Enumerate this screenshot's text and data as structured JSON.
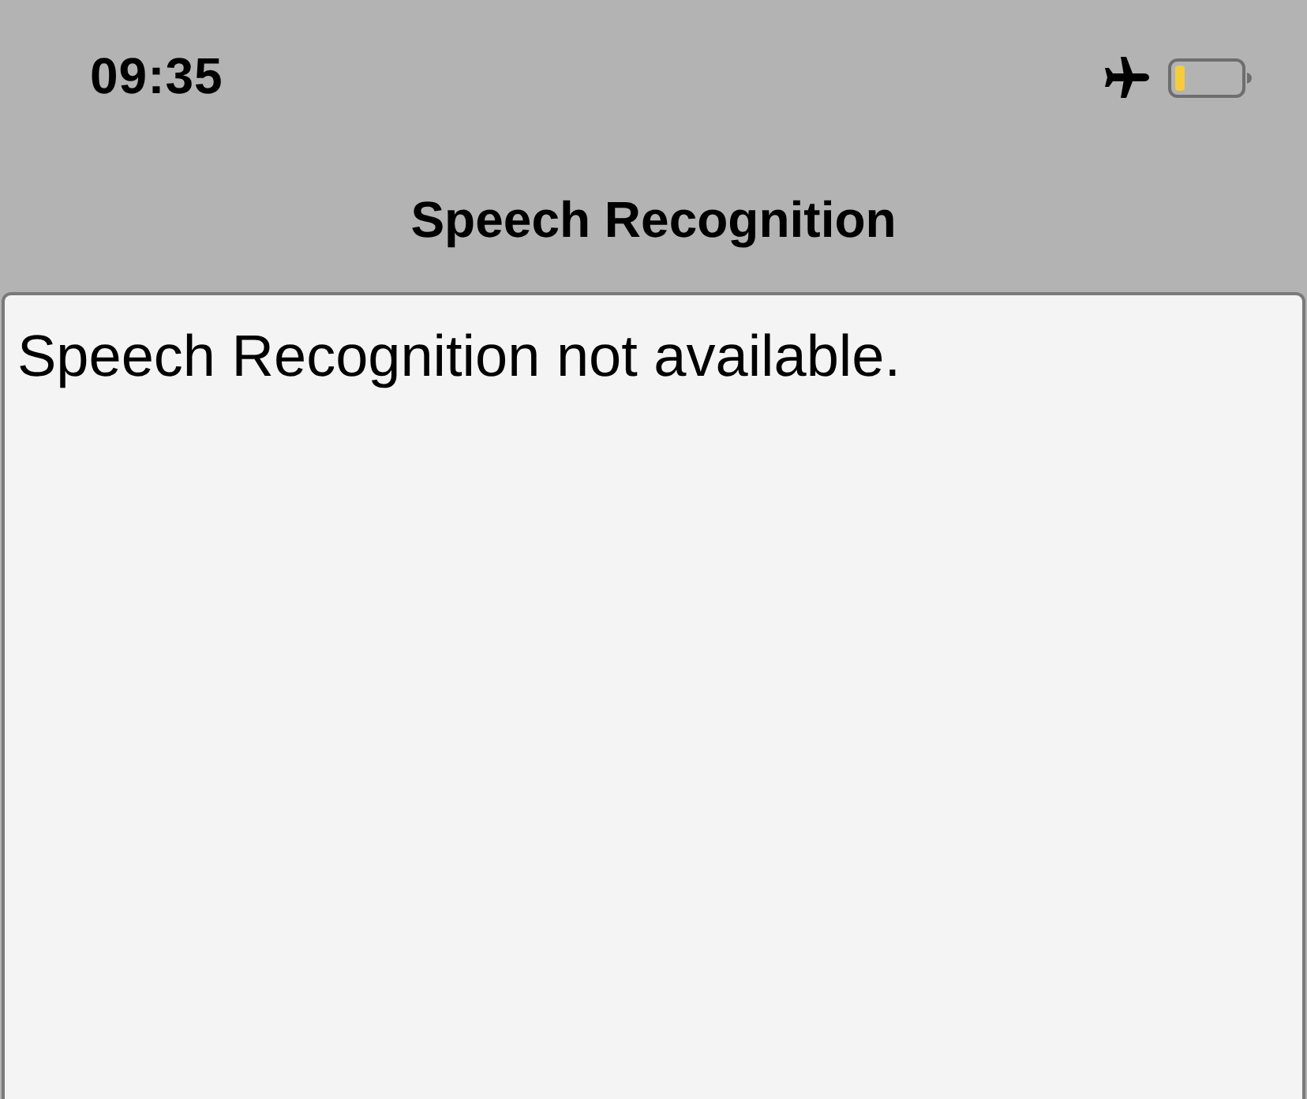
{
  "status_bar": {
    "time": "09:35"
  },
  "navigation_bar": {
    "title": "Speech Recognition"
  },
  "text_view": {
    "text": "Speech Recognition not available."
  }
}
